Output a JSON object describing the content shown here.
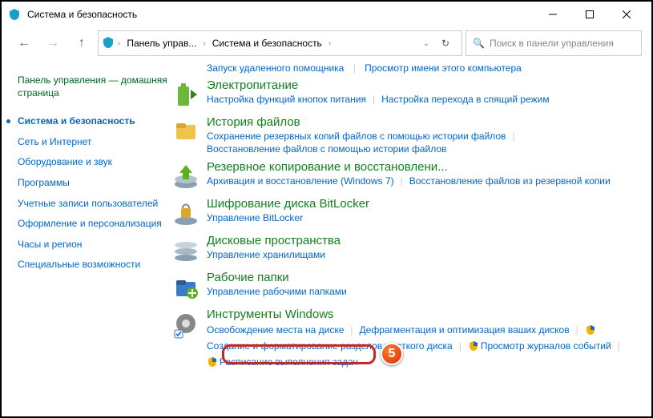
{
  "window": {
    "title": "Система и безопасность"
  },
  "breadcrumb": {
    "seg1": "Панель управ...",
    "seg2": "Система и безопасность"
  },
  "search": {
    "placeholder": "Поиск в панели управления"
  },
  "sidebar": {
    "home": "Панель управления — домашняя страница",
    "items": [
      "Система и безопасность",
      "Сеть и Интернет",
      "Оборудование и звук",
      "Программы",
      "Учетные записи пользователей",
      "Оформление и персонализация",
      "Часы и регион",
      "Специальные возможности"
    ]
  },
  "topcut": {
    "a": "Запуск удаленного помощника",
    "b": "Просмотр имени этого компьютера"
  },
  "cats": [
    {
      "title": "Электропитание",
      "links": [
        "Настройка функций кнопок питания",
        "Настройка перехода в спящий режим"
      ]
    },
    {
      "title": "История файлов",
      "links": [
        "Сохранение резервных копий файлов с помощью истории файлов",
        "Восстановление файлов с помощью истории файлов"
      ]
    },
    {
      "title": "Резервное копирование и восстановлени...",
      "links": [
        "Архивация и восстановление (Windows 7)",
        "Восстановление файлов из резервной копии"
      ]
    },
    {
      "title": "Шифрование диска BitLocker",
      "links": [
        "Управление BitLocker"
      ]
    },
    {
      "title": "Дисковые пространства",
      "links": [
        "Управление хранилищами"
      ]
    },
    {
      "title": "Рабочие папки",
      "links": [
        "Управление рабочими папками"
      ]
    },
    {
      "title": "Инструменты Windows",
      "links": [
        "Освобождение места на диске",
        "Дефрагментация и оптимизация ваших дисков",
        "Создание и форматирование разделов жесткого диска",
        "Просмотр журналов событий",
        "Расписание выполнения задач"
      ],
      "shield": [
        false,
        false,
        true,
        true,
        true
      ]
    }
  ],
  "callout": "5"
}
